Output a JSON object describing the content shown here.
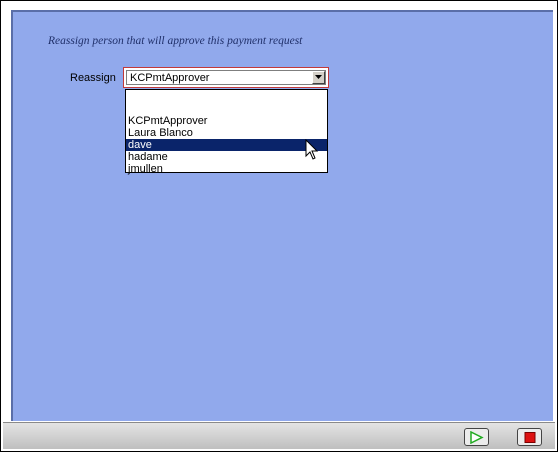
{
  "form": {
    "instruction": "Reassign person that will approve this payment request",
    "reassign_label": "Reassign",
    "selected_value": "KCPmtApprover"
  },
  "dropdown": {
    "options": [
      "",
      "KCPmtApprover",
      "Laura Blanco",
      "dave",
      "hadame",
      "jmullen"
    ],
    "highlighted": "dave"
  },
  "colors": {
    "panel_background": "#91a9ec",
    "selection_highlight": "#0a246a",
    "play_icon": "#22aa22",
    "stop_icon": "#dd1111"
  },
  "icons": {
    "dropdown_arrow": "chevron-down-icon",
    "cursor": "mouse-pointer-icon",
    "play": "play-icon",
    "stop": "stop-icon"
  }
}
